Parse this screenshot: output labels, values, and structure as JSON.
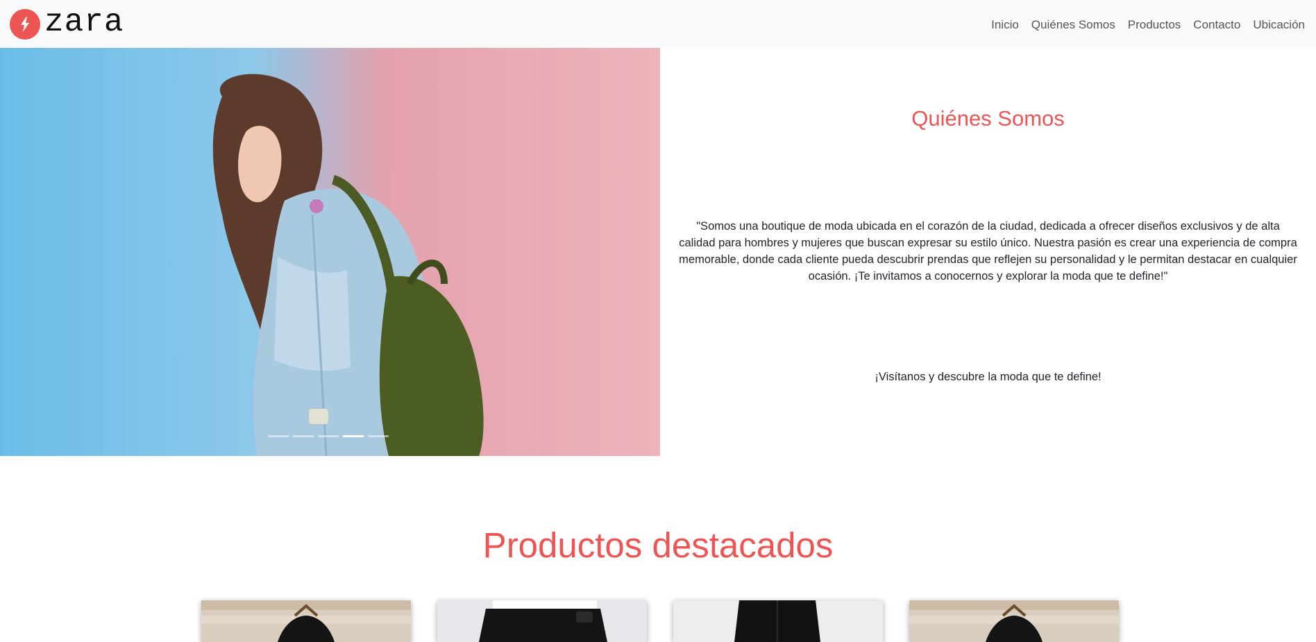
{
  "navbar": {
    "brand": "zara",
    "links": [
      "Inicio",
      "Quiénes Somos",
      "Productos",
      "Contacto",
      "Ubicación"
    ]
  },
  "hero": {
    "about_title": "Quiénes Somos",
    "about_text": "\"Somos una boutique de moda ubicada en el corazón de la ciudad, dedicada a ofrecer diseños exclusivos y de alta calidad para hombres y mujeres que buscan expresar su estilo único. Nuestra pasión es crear una experiencia de compra memorable, donde cada cliente pueda descubrir prendas que reflejen su personalidad y le permitan destacar en cualquier ocasión. ¡Te invitamos a conocernos y explorar la moda que te define!\"",
    "cta": "¡Visítanos y descubre la moda que te define!",
    "carousel": {
      "slides": 5,
      "active_slide": 4
    }
  },
  "products": {
    "title": "Productos destacados",
    "items": [
      {
        "image": "black-tshirt-on-hanger"
      },
      {
        "image": "black-pants-on-model"
      },
      {
        "image": "black-pants-on-model"
      },
      {
        "image": "black-tshirt-on-hanger"
      }
    ]
  },
  "colors": {
    "accent": "#ed5454",
    "navbar_bg": "#f8f9fa",
    "nav_link": "#555555",
    "text": "#212529"
  }
}
